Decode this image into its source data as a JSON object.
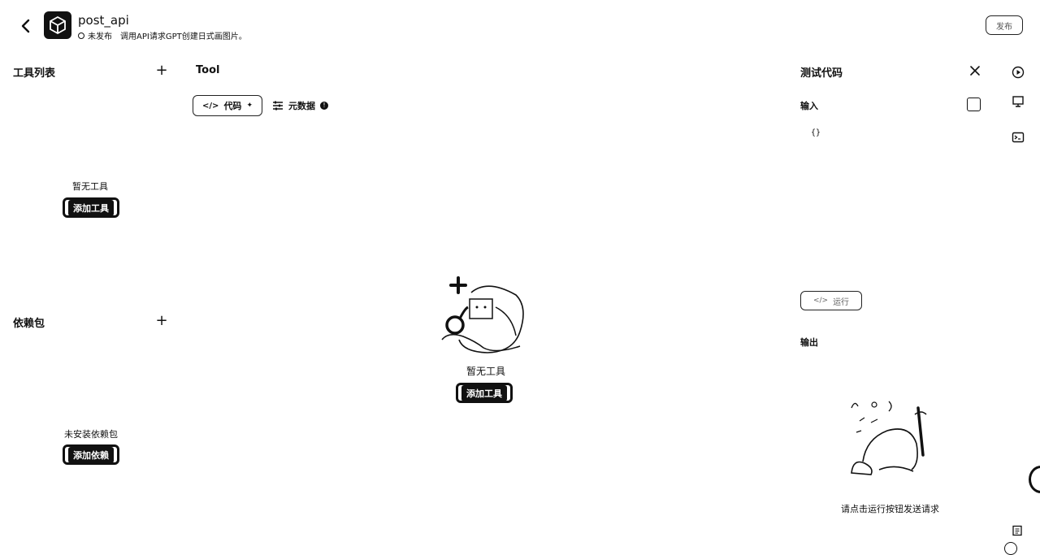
{
  "header": {
    "title": "post_api",
    "status": "未发布",
    "description": "调用API请求GPT创建日式画图片。",
    "publish_label": "发布"
  },
  "left": {
    "tools_title": "工具列表",
    "tools_empty": "暂无工具",
    "tools_add": "添加工具",
    "deps_title": "依赖包",
    "deps_empty": "未安装依赖包",
    "deps_add": "添加依赖"
  },
  "main": {
    "title": "Tool",
    "tab_code": "代码",
    "tab_metadata": "元数据",
    "empty": "暂无工具",
    "add": "添加工具"
  },
  "test": {
    "title": "测试代码",
    "input_label": "输入",
    "input_value": "{}",
    "run_label": "运行",
    "output_label": "输出",
    "output_empty": "请点击运行按钮发送请求"
  },
  "icons": {
    "back": "chevron-left-icon",
    "logo": "cube-icon",
    "close": "close-icon",
    "play": "play-circle-icon",
    "monitor": "monitor-icon",
    "terminal": "terminal-icon",
    "doc": "document-icon"
  }
}
